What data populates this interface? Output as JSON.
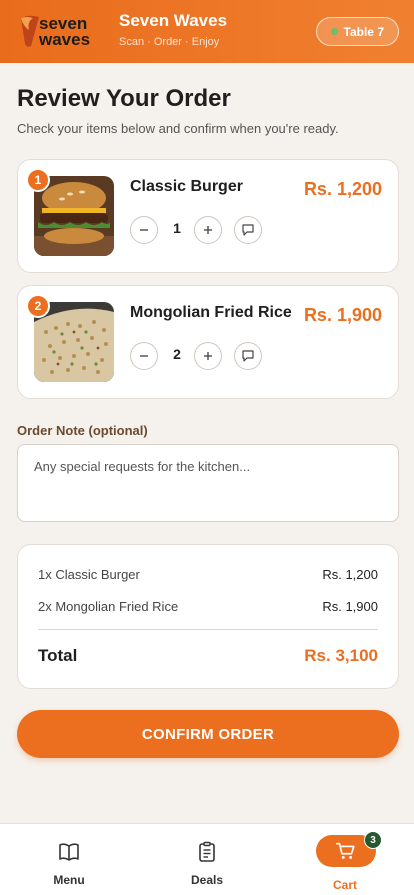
{
  "header": {
    "logo_text_top": "seven",
    "logo_text_bottom": "waves",
    "brand_name": "Seven Waves",
    "tagline": "Scan · Order · Enjoy",
    "table_label": "Table 7",
    "accent_color": "#ec6f1f"
  },
  "page": {
    "title": "Review Your Order",
    "subtitle": "Check your items below and confirm when you're ready."
  },
  "items": [
    {
      "index": "1",
      "name": "Classic Burger",
      "price": "Rs. 1,200",
      "qty": "1",
      "image": "burger"
    },
    {
      "index": "2",
      "name": "Mongolian Fried Rice",
      "price": "Rs. 1,900",
      "qty": "2",
      "image": "fried-rice"
    }
  ],
  "note": {
    "label": "Order Note (optional)",
    "placeholder": "Any special requests for the kitchen...",
    "value": ""
  },
  "summary": {
    "lines": [
      {
        "label": "1x Classic Burger",
        "value": "Rs. 1,200"
      },
      {
        "label": "2x Mongolian Fried Rice",
        "value": "Rs. 1,900"
      }
    ],
    "total_label": "Total",
    "total_value": "Rs. 3,100"
  },
  "confirm_label": "CONFIRM ORDER",
  "nav": {
    "items": [
      {
        "label": "Menu",
        "icon": "book-icon"
      },
      {
        "label": "Deals",
        "icon": "clipboard-icon"
      },
      {
        "label": "Cart",
        "icon": "cart-icon",
        "active": true,
        "badge": "3"
      }
    ]
  }
}
